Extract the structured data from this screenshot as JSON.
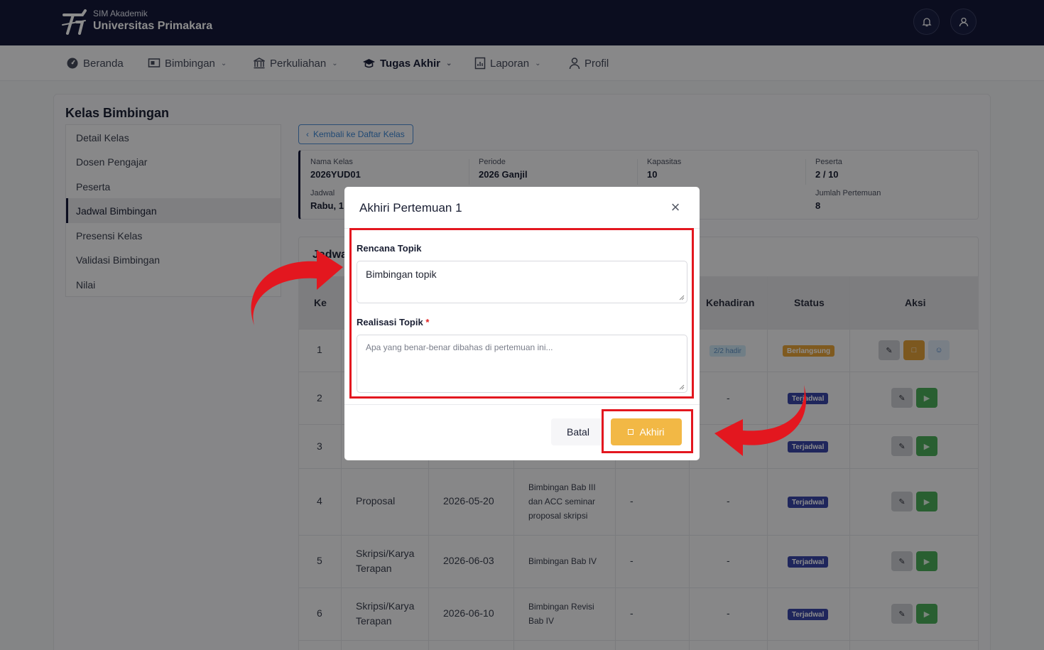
{
  "header": {
    "subtitle": "SIM Akademik",
    "title": "Universitas Primakara",
    "icons": [
      "bell-icon",
      "user-icon"
    ]
  },
  "nav": {
    "items": [
      {
        "label": "Beranda",
        "icon": "dashboard-icon",
        "dropdown": false
      },
      {
        "label": "Bimbingan",
        "icon": "presentation-icon",
        "dropdown": true
      },
      {
        "label": "Perkuliahan",
        "icon": "building-icon",
        "dropdown": true
      },
      {
        "label": "Tugas Akhir",
        "icon": "graduation-cap-icon",
        "dropdown": true,
        "active": true
      },
      {
        "label": "Laporan",
        "icon": "report-icon",
        "dropdown": true
      },
      {
        "label": "Profil",
        "icon": "user-icon",
        "dropdown": false
      }
    ]
  },
  "page": {
    "title": "Kelas Bimbingan",
    "back_label": "Kembali ke Daftar Kelas",
    "section_title": "Jadwa"
  },
  "sidebar": {
    "items": [
      {
        "label": "Detail Kelas"
      },
      {
        "label": "Dosen Pengajar"
      },
      {
        "label": "Peserta"
      },
      {
        "label": "Jadwal Bimbingan",
        "active": true
      },
      {
        "label": "Presensi Kelas"
      },
      {
        "label": "Validasi Bimbingan"
      },
      {
        "label": "Nilai"
      }
    ]
  },
  "info": {
    "nama_kelas_label": "Nama Kelas",
    "nama_kelas": "2026YUD01",
    "periode_label": "Periode",
    "periode": "2026 Ganjil",
    "kapasitas_label": "Kapasitas",
    "kapasitas": "10",
    "peserta_label": "Peserta",
    "peserta": "2 / 10",
    "jadwal_label": "Jadwal",
    "jadwal": "Rabu, 1",
    "jumlah_label": "Jumlah Pertemuan",
    "jumlah": "8"
  },
  "table": {
    "headers": {
      "ke": "Ke",
      "kehadiran": "Kehadiran",
      "status": "Status",
      "aksi": "Aksi"
    },
    "rows": [
      {
        "ke": "1",
        "tahap": "",
        "tanggal": "",
        "topik": "",
        "realisasi": "",
        "kehadiran": "2/2 hadir",
        "status": "Berlangsung"
      },
      {
        "ke": "2",
        "tahap": "",
        "tanggal": "",
        "topik": "",
        "realisasi": "",
        "kehadiran": "-",
        "status": "Terjadwal"
      },
      {
        "ke": "3",
        "tahap": "",
        "tanggal": "",
        "topik": "",
        "realisasi": "",
        "kehadiran": "",
        "status": "Terjadwal"
      },
      {
        "ke": "4",
        "tahap": "Proposal",
        "tanggal": "2026-05-20",
        "topik": "Bimbingan Bab III dan ACC seminar proposal skripsi",
        "realisasi": "-",
        "kehadiran": "-",
        "status": "Terjadwal"
      },
      {
        "ke": "5",
        "tahap": "Skripsi/Karya Terapan",
        "tanggal": "2026-06-03",
        "topik": "Bimbingan Bab IV",
        "realisasi": "-",
        "kehadiran": "-",
        "status": "Terjadwal"
      },
      {
        "ke": "6",
        "tahap": "Skripsi/Karya Terapan",
        "tanggal": "2026-06-10",
        "topik": "Bimbingan Revisi Bab IV",
        "realisasi": "-",
        "kehadiran": "-",
        "status": "Terjadwal"
      }
    ]
  },
  "modal": {
    "title": "Akhiri Pertemuan 1",
    "rencana_label": "Rencana Topik",
    "rencana_value": "Bimbingan topik",
    "realisasi_label": "Realisasi Topik",
    "required_mark": "*",
    "realisasi_placeholder": "Apa yang benar-benar dibahas di pertemuan ini...",
    "cancel_label": "Batal",
    "confirm_label": "Akhiri"
  },
  "colors": {
    "header_bg": "#14193a",
    "accent_orange": "#f2b845",
    "highlight_red": "#e3171f",
    "scheduled_badge": "#3946a8",
    "play_green": "#4cae5a"
  }
}
